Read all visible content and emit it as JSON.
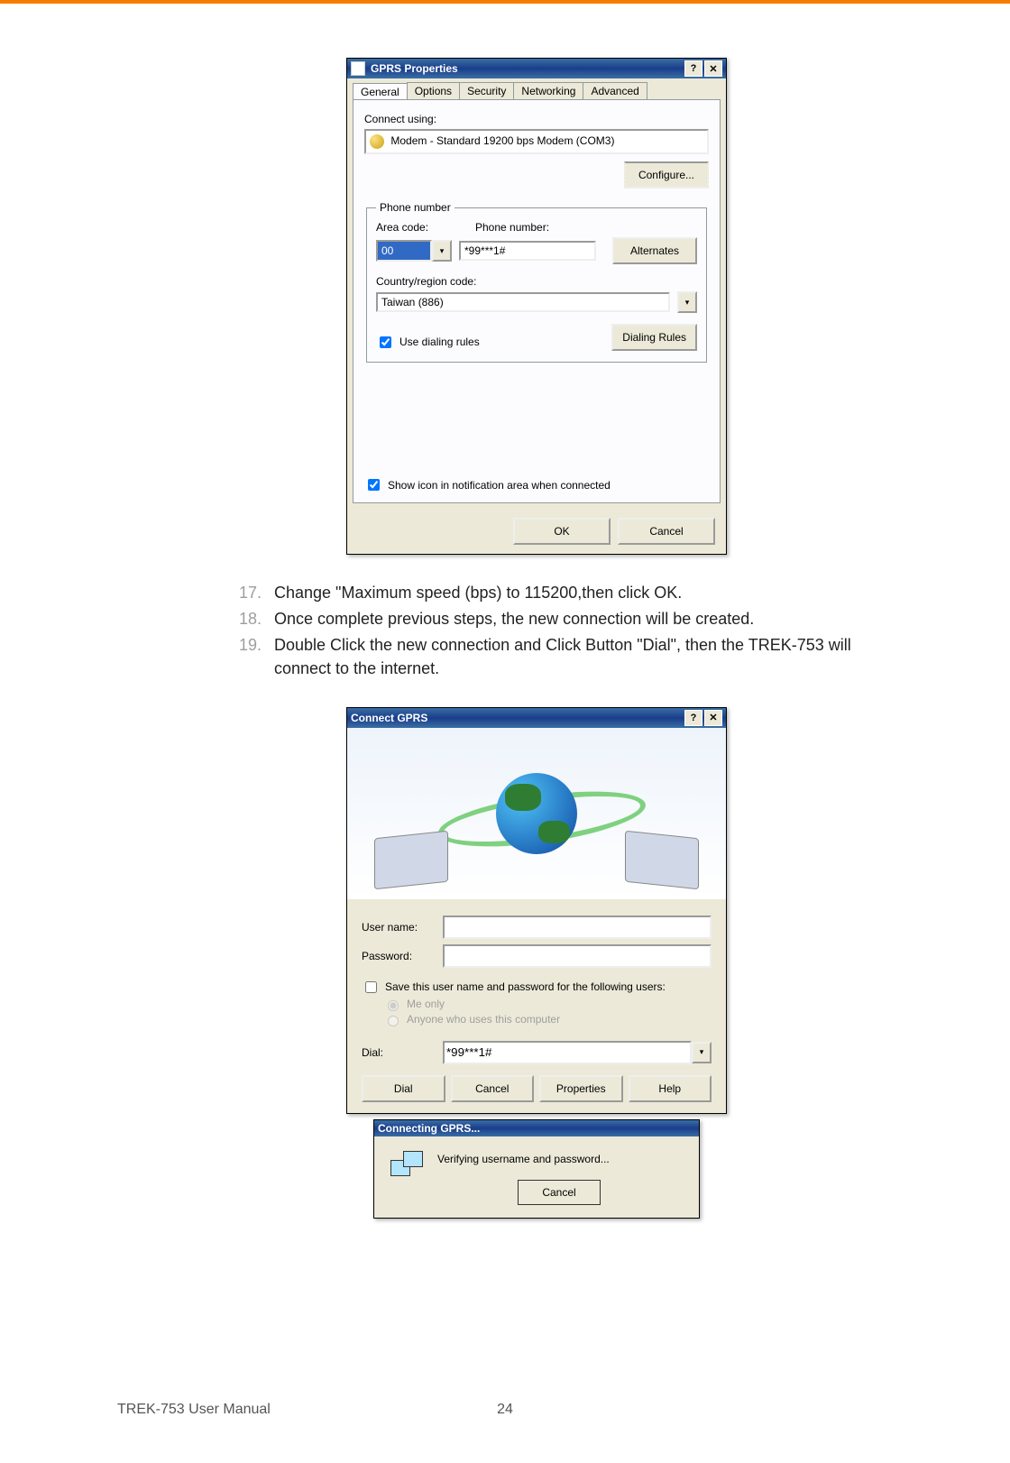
{
  "dlg1": {
    "title": "GPRS Properties",
    "tabs": [
      "General",
      "Options",
      "Security",
      "Networking",
      "Advanced"
    ],
    "connect_using_label": "Connect using:",
    "modem": "Modem - Standard 19200 bps Modem (COM3)",
    "configure": "Configure...",
    "phone_group": "Phone number",
    "area_label": "Area code:",
    "area_value": "00",
    "phone_label": "Phone number:",
    "phone_value": "*99***1#",
    "alternates": "Alternates",
    "country_label": "Country/region code:",
    "country_value": "Taiwan (886)",
    "use_rules": "Use dialing rules",
    "dialing_rules": "Dialing Rules",
    "show_icon": "Show icon in notification area when connected",
    "ok": "OK",
    "cancel": "Cancel"
  },
  "steps": {
    "s17n": "17.",
    "s17": "Change \"Maximum speed (bps) to 115200,then click OK.",
    "s18n": "18.",
    "s18": "Once complete previous steps, the new connection will be created.",
    "s19n": "19.",
    "s19": "Double Click the new connection and Click Button \"Dial\", then the TREK-753 will connect to the internet."
  },
  "dlg2": {
    "title": "Connect GPRS",
    "user_label": "User name:",
    "pass_label": "Password:",
    "save_label": "Save this user name and password for the following users:",
    "me_only": "Me only",
    "anyone": "Anyone who uses this computer",
    "dial_label": "Dial:",
    "dial_value": "*99***1#",
    "btn_dial": "Dial",
    "btn_cancel": "Cancel",
    "btn_props": "Properties",
    "btn_help": "Help"
  },
  "dlg3": {
    "title": "Connecting GPRS...",
    "msg": "Verifying username and password...",
    "cancel": "Cancel"
  },
  "footer": {
    "left": "TREK-753 User Manual",
    "page": "24"
  }
}
